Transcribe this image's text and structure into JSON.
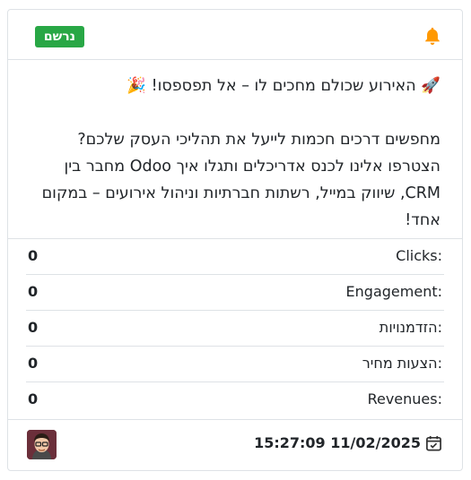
{
  "header": {
    "status_badge": "נרשם",
    "icon": "bell-icon",
    "accent_color": "#ff9800",
    "badge_color": "#28a745"
  },
  "post": {
    "line1": "🚀 האירוע שכולם מחכים לו – אל תפספסו! 🎉",
    "paragraph": "מחפשים דרכים חכמות לייעל את תהליכי העסק שלכם? הצטרפו אלינו לכנס אדריכלים ותגלו איך Odoo מחבר בין CRM, שיווק במייל, רשתות חברתיות וניהול אירועים – במקום אחד!"
  },
  "stats": [
    {
      "label": "Clicks:",
      "value": "0"
    },
    {
      "label": "Engagement:",
      "value": "0"
    },
    {
      "label": "הזדמנויות:",
      "value": "0"
    },
    {
      "label": "הצעות מחיר:",
      "value": "0"
    },
    {
      "label": "Revenues:",
      "value": "0"
    }
  ],
  "footer": {
    "datetime": "15:27:09 11/02/2025",
    "calendar_icon": "calendar-check-icon",
    "avatar": "user-avatar"
  }
}
